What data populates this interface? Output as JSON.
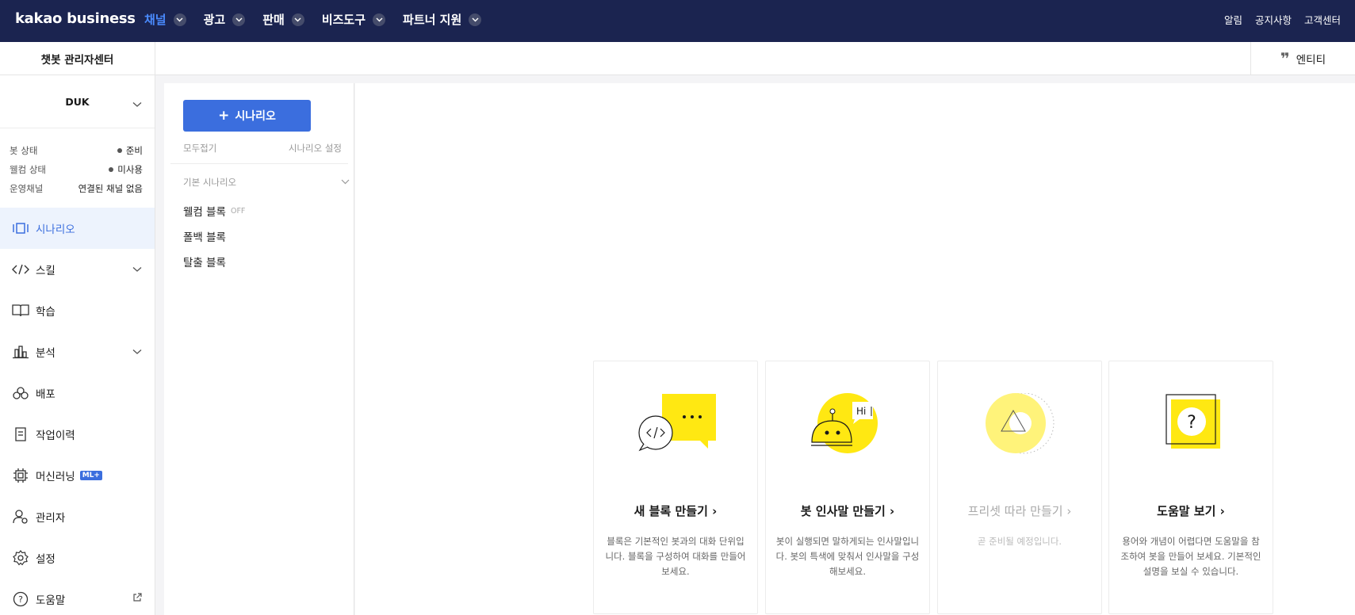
{
  "topnav": {
    "logo": "kakao business",
    "menu": [
      {
        "label": "채널",
        "active": true
      },
      {
        "label": "광고"
      },
      {
        "label": "판매"
      },
      {
        "label": "비즈도구"
      },
      {
        "label": "파트너 지원"
      }
    ],
    "util": [
      "알림",
      "공지사항",
      "고객센터"
    ]
  },
  "subhead": {
    "center_title": "챗봇 관리자센터",
    "entity_label": "엔티티"
  },
  "sidebar": {
    "bot_name": "DUK",
    "status": [
      {
        "label": "봇 상태",
        "value": "준비",
        "dot": true
      },
      {
        "label": "웰컴 상태",
        "value": "미사용",
        "dot": true
      },
      {
        "label": "운영채널",
        "value": "연결된 채널 없음",
        "dot": false
      }
    ],
    "nav": [
      {
        "label": "시나리오",
        "icon": "scenario-icon",
        "active": true
      },
      {
        "label": "스킬",
        "icon": "code-icon",
        "expandable": true
      },
      {
        "label": "학습",
        "icon": "book-icon"
      },
      {
        "label": "분석",
        "icon": "bar-chart-icon",
        "expandable": true
      },
      {
        "label": "배포",
        "icon": "deploy-icon"
      },
      {
        "label": "작업이력",
        "icon": "history-icon"
      },
      {
        "label": "머신러닝",
        "icon": "chip-icon",
        "badge": "ML+"
      },
      {
        "label": "관리자",
        "icon": "admin-icon"
      },
      {
        "label": "설정",
        "icon": "gear-icon"
      },
      {
        "label": "도움말",
        "icon": "help-icon",
        "external": true
      }
    ]
  },
  "scenario": {
    "add_button": "시나리오",
    "collapse_all": "모두접기",
    "settings": "시나리오 설정",
    "group_label": "기본 시나리오",
    "blocks": [
      {
        "label": "웰컴 블록",
        "tag": "OFF"
      },
      {
        "label": "폴백 블록",
        "tag": ""
      },
      {
        "label": "탈출 블록",
        "tag": ""
      }
    ]
  },
  "cards": [
    {
      "title": "새 블록 만들기",
      "desc": "블록은 기본적인 봇과의 대화 단위입니다. 블록을 구성하여 대화를 만들어보세요.",
      "disabled": false
    },
    {
      "title": "봇 인사말 만들기",
      "desc": "봇이 실행되면 말하게되는 인사말입니다. 봇의 특색에 맞춰서 인사말을 구성해보세요.",
      "illu_text": "Hi",
      "disabled": false
    },
    {
      "title": "프리셋 따라 만들기",
      "desc": "곧 준비될 예정입니다.",
      "disabled": true
    },
    {
      "title": "도움말 보기",
      "desc": "용어와 개념이 어렵다면 도움말을 참조하여 봇을 만들어 보세요. 기본적인 설명을 보실 수 있습니다.",
      "illu_text": "?",
      "disabled": false
    }
  ],
  "colors": {
    "nav_bg": "#1b2450",
    "accent": "#3b6ede",
    "active_menu": "#4a8bff",
    "yellow": "#ffe812"
  }
}
